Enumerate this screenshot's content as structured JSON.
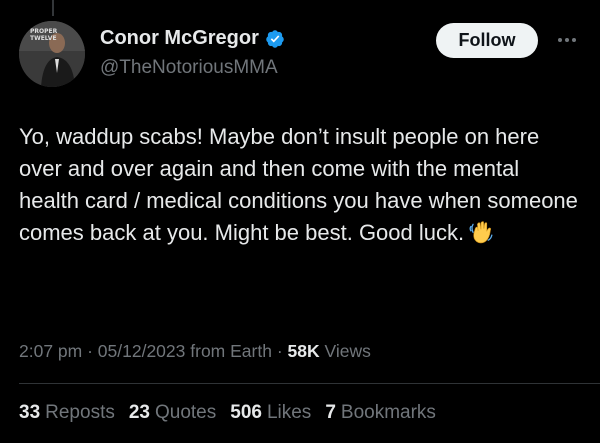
{
  "author": {
    "display_name": "Conor McGregor",
    "handle": "@TheNotoriousMMA",
    "verified": true,
    "avatar_logo_text": "PROPER TWELVE"
  },
  "actions": {
    "follow_label": "Follow",
    "more_icon": "more-horizontal-icon"
  },
  "tweet": {
    "text": "Yo, waddup scabs! Maybe don’t insult people on here over and over again and then come with the mental health card / medical conditions you have when someone comes back at you. Might be best. Good luck.",
    "emoji_icon": "waving-hand-emoji"
  },
  "meta": {
    "time": "2:07 pm",
    "sep1": " · ",
    "date": "05/12/2023",
    "from": " from Earth",
    "sep2": " · ",
    "views_count": "58K",
    "views_label": " Views"
  },
  "stats": [
    {
      "count": "33",
      "label": "Reposts"
    },
    {
      "count": "23",
      "label": "Quotes"
    },
    {
      "count": "506",
      "label": "Likes"
    },
    {
      "count": "7",
      "label": "Bookmarks"
    }
  ],
  "colors": {
    "background": "#000000",
    "text": "#e7e9ea",
    "muted": "#71767b",
    "verified": "#1d9bf0",
    "button_bg": "#eff3f4"
  }
}
